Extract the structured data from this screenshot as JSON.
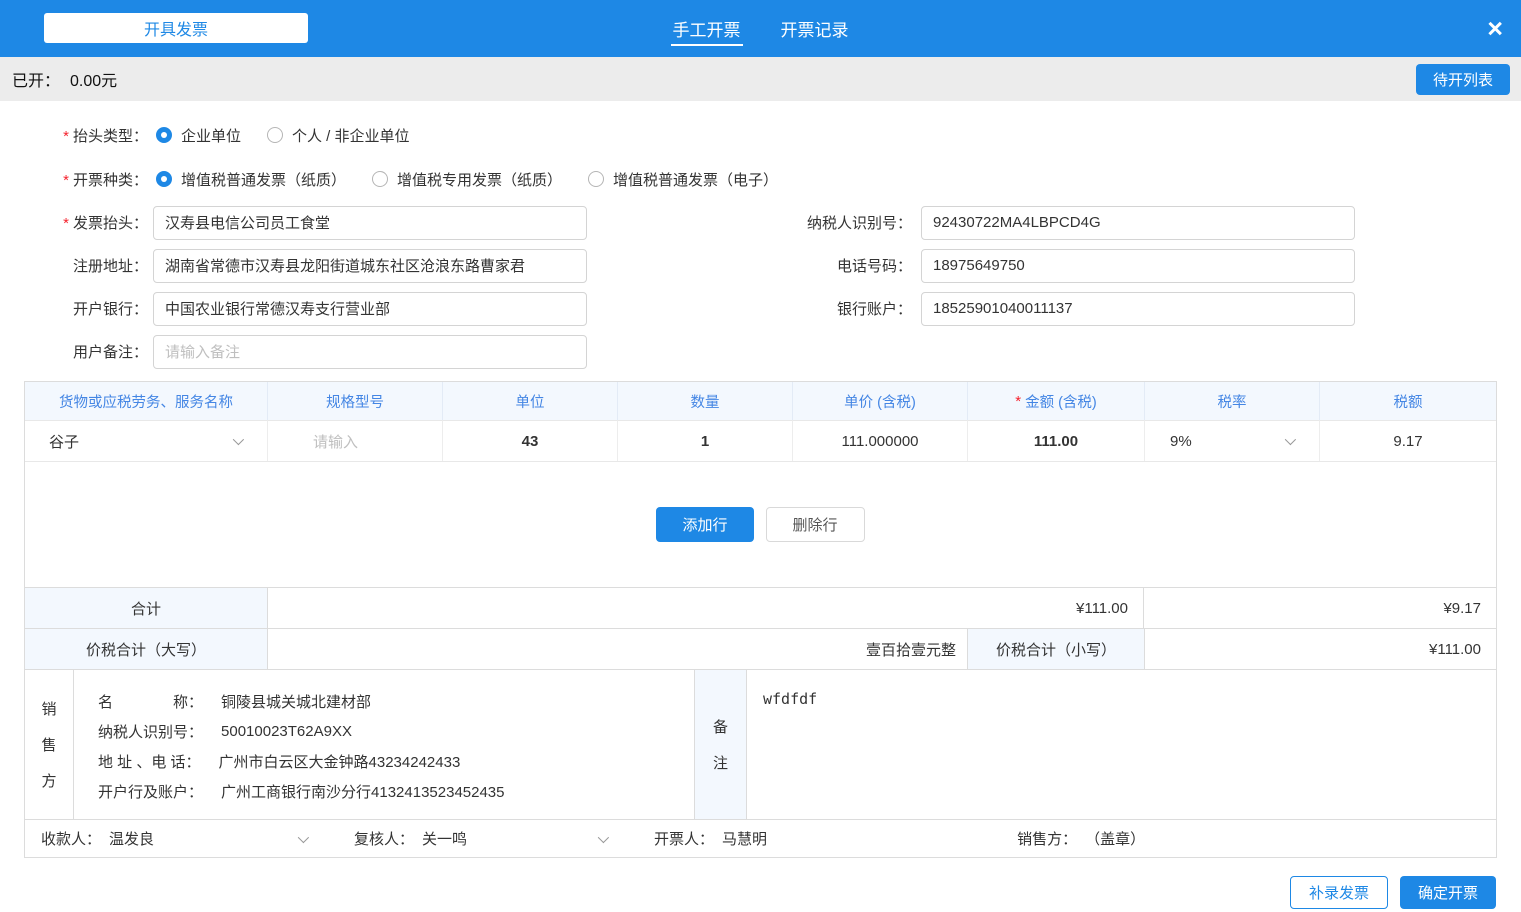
{
  "required_mark": "*",
  "colors": {
    "accent_blue": "#1E88E5",
    "table_header_text": "#4486E4",
    "required_red": "#F5222D",
    "subbar_gray": "#ECECEC",
    "table_header_bg": "#F3F8FE"
  },
  "header": {
    "title": "开具发票",
    "tabs": [
      {
        "label": "手工开票",
        "active": true
      },
      {
        "label": "开票记录",
        "active": false
      }
    ],
    "close_glyph": "×"
  },
  "subheader": {
    "issued_label": "已开：",
    "issued_value": "0.00元",
    "pending_button": "待开列表"
  },
  "form": {
    "header_type": {
      "label": "抬头类型：",
      "options": [
        {
          "label": "企业单位",
          "selected": true
        },
        {
          "label": "个人 / 非企业单位",
          "selected": false
        }
      ]
    },
    "invoice_kind": {
      "label": "开票种类：",
      "options": [
        {
          "label": "增值税普通发票（纸质）",
          "selected": true
        },
        {
          "label": "增值税专用发票（纸质）",
          "selected": false
        },
        {
          "label": "增值税普通发票（电子）",
          "selected": false
        }
      ]
    },
    "invoice_title": {
      "label": "发票抬头：",
      "value": "汉寿县电信公司员工食堂"
    },
    "taxpayer_id": {
      "label": "纳税人识别号：",
      "value": "92430722MA4LBPCD4G"
    },
    "registered_address": {
      "label": "注册地址：",
      "value": "湖南省常德市汉寿县龙阳街道城东社区沧浪东路曹家君"
    },
    "phone": {
      "label": "电话号码：",
      "value": "18975649750"
    },
    "bank": {
      "label": "开户银行：",
      "value": "中国农业银行常德汉寿支行营业部"
    },
    "bank_account": {
      "label": "银行账户：",
      "value": "18525901040011137"
    },
    "remark": {
      "label": "用户备注：",
      "placeholder": "请输入备注"
    }
  },
  "items_table": {
    "columns": [
      "货物或应税劳务、服务名称",
      "规格型号",
      "单位",
      "数量",
      "单价 (含税)",
      "金额 (含税)",
      "税率",
      "税额"
    ],
    "row": {
      "name": "谷子",
      "spec_placeholder": "请输入",
      "unit": "43",
      "quantity": "1",
      "unit_price": "111.000000",
      "amount": "111.00",
      "tax_rate": "9%",
      "tax": "9.17"
    },
    "add_row_button": "添加行",
    "delete_row_button": "删除行",
    "totals": {
      "label": "合计",
      "amount": "¥111.00",
      "tax": "¥9.17"
    },
    "grand_total": {
      "words_label": "价税合计（大写）",
      "words_value": "壹百拾壹元整",
      "numeric_label": "价税合计（小写）",
      "numeric_value": "¥111.00"
    }
  },
  "seller": {
    "vertical_chars": [
      "销",
      "售",
      "方"
    ],
    "rows": [
      {
        "label": "名　　　　称：",
        "value": "铜陵县城关城北建材部"
      },
      {
        "label": "纳税人识别号：",
        "value": "50010023T62A9XX"
      },
      {
        "label": "地 址 、电 话：",
        "value": "广州市白云区大金钟路43234242433"
      },
      {
        "label": "开户行及账户：",
        "value": "广州工商银行南沙分行4132413523452435"
      }
    ],
    "remark_vertical_chars": [
      "备",
      "注"
    ],
    "remark_value": "wfdfdf"
  },
  "sign_row": {
    "payee_label": "收款人：",
    "payee": "温发良",
    "reviewer_label": "复核人：",
    "reviewer": "关一鸣",
    "issuer_label": "开票人：",
    "issuer": "马慧明",
    "seller_label": "销售方：",
    "seller_value": "（盖章）"
  },
  "actions": {
    "supplement_button": "补录发票",
    "confirm_button": "确定开票"
  }
}
